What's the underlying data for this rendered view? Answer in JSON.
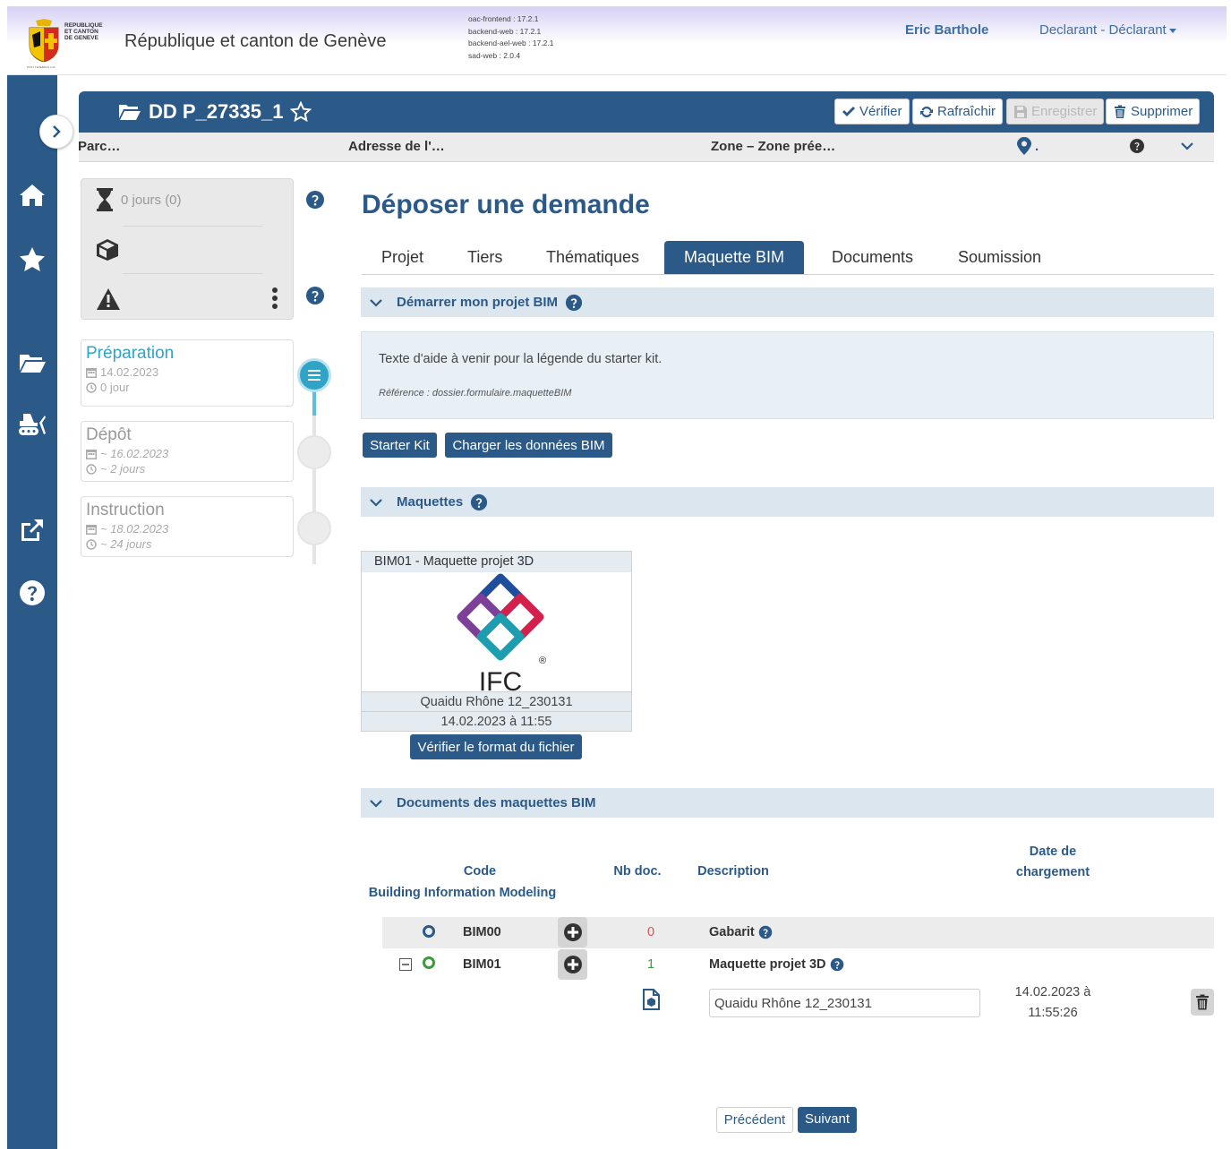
{
  "header": {
    "logo_text": "REPUBLIQUE ET CANTON DE GENEVE",
    "logo_line1": "REPUBLIQUE",
    "logo_line2": "ET CANTON",
    "logo_line3": "DE GENEVE",
    "logo_motto": "POST TENEBRAS LUX",
    "site_title": "République et canton de Genève",
    "versions": [
      "oac-frontend : 17.2.1",
      "backend-web : 17.2.1",
      "backend-ael-web : 17.2.1",
      "sad-web : 2.0.4"
    ],
    "user_name": "Eric Barthole",
    "role": "Declarant - Déclarant"
  },
  "sidebar": {
    "icons": [
      "home-icon",
      "star-icon",
      "folder-open-icon",
      "bulldozer-icon",
      "external-link-icon",
      "question-circle-icon"
    ]
  },
  "dossier": {
    "title": "DD P_27335_1",
    "actions": {
      "verify": "Vérifier",
      "refresh": "Rafraîchir",
      "save": "Enregistrer",
      "delete": "Supprimer"
    },
    "info": {
      "parcel": "Parc…",
      "address": "Adresse de l'…",
      "zone": "Zone – Zone prée…",
      "location_dot": "."
    }
  },
  "status": {
    "days": "0 jours (0)"
  },
  "steps": [
    {
      "title": "Préparation",
      "date": "14.02.2023",
      "duration": "0 jour",
      "state": "active"
    },
    {
      "title": "Dépôt",
      "date": "~ 16.02.2023",
      "duration": "~ 2 jours",
      "state": "pending"
    },
    {
      "title": "Instruction",
      "date": "~ 18.02.2023",
      "duration": "~ 24 jours",
      "state": "pending"
    }
  ],
  "main": {
    "page_title": "Déposer une demande",
    "tabs": [
      "Projet",
      "Tiers",
      "Thématiques",
      "Maquette BIM",
      "Documents",
      "Soumission"
    ],
    "active_tab": "Maquette BIM",
    "section_start": "Démarrer mon projet BIM",
    "help_text": "Texte d'aide à venir pour la légende du starter kit.",
    "help_ref": "Référence : dossier.formulaire.maquetteBIM",
    "btn_starter": "Starter Kit",
    "btn_load": "Charger les données BIM",
    "section_models": "Maquettes",
    "model_card": {
      "header": "BIM01 - Maquette projet 3D",
      "logo_text": "IFC",
      "registered": "®",
      "file_name": "Quaidu Rhône 12_230131",
      "date": "14.02.2023 à 11:55",
      "btn_verify": "Vérifier le format du fichier"
    },
    "section_docs": "Documents des maquettes BIM",
    "table": {
      "col_code_1": "Code",
      "col_code_2": "Building Information Modeling",
      "col_nb": "Nb doc.",
      "col_desc": "Description",
      "col_date_1": "Date de",
      "col_date_2": "chargement",
      "rows": [
        {
          "code": "BIM00",
          "nb": "0",
          "description": "Gabarit"
        },
        {
          "code": "BIM01",
          "nb": "1",
          "description": "Maquette projet 3D"
        }
      ],
      "file": {
        "name": "Quaidu Rhône 12_230131",
        "date_1": "14.02.2023 à",
        "date_2": "11:55:26"
      }
    },
    "nav": {
      "prev": "Précédent",
      "next": "Suivant"
    }
  },
  "colors": {
    "primary": "#2b5a89",
    "accent": "#2fa4c7",
    "danger": "#d9534f",
    "success": "#3c9a3c"
  }
}
